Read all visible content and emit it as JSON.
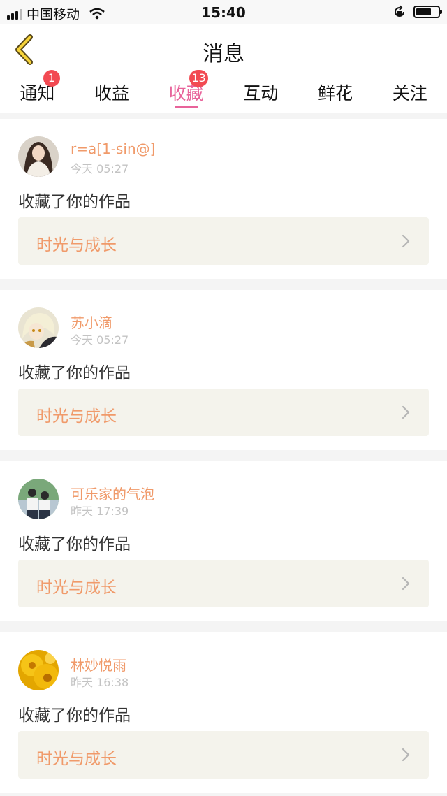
{
  "status_bar": {
    "carrier": "中国移动",
    "time": "15:40",
    "battery_level": 0.7
  },
  "header": {
    "title": "消息"
  },
  "tabs": [
    {
      "label": "通知",
      "badge": "1",
      "active": false
    },
    {
      "label": "收益",
      "badge": "",
      "active": false
    },
    {
      "label": "收藏",
      "badge": "13",
      "active": true
    },
    {
      "label": "互动",
      "badge": "",
      "active": false
    },
    {
      "label": "鲜花",
      "badge": "",
      "active": false
    },
    {
      "label": "关注",
      "badge": "",
      "active": false
    }
  ],
  "colors": {
    "accent_pink": "#e8639a",
    "badge_red": "#f24a52",
    "name_orange": "#f09a6a"
  },
  "messages": [
    {
      "username": "r=a[1-sin@]",
      "time": "今天 05:27",
      "action": "收藏了你的作品",
      "work_title": "时光与成长",
      "avatar": "woman-portrait-avatar"
    },
    {
      "username": "苏小滴",
      "time": "今天 05:27",
      "action": "收藏了你的作品",
      "work_title": "时光与成长",
      "avatar": "anime-character-avatar"
    },
    {
      "username": "可乐家的气泡",
      "time": "昨天 17:39",
      "action": "收藏了你的作品",
      "work_title": "时光与成长",
      "avatar": "students-photo-avatar"
    },
    {
      "username": "林妙悦雨",
      "time": "昨天 16:38",
      "action": "收藏了你的作品",
      "work_title": "时光与成长",
      "avatar": "sunflower-avatar"
    }
  ]
}
